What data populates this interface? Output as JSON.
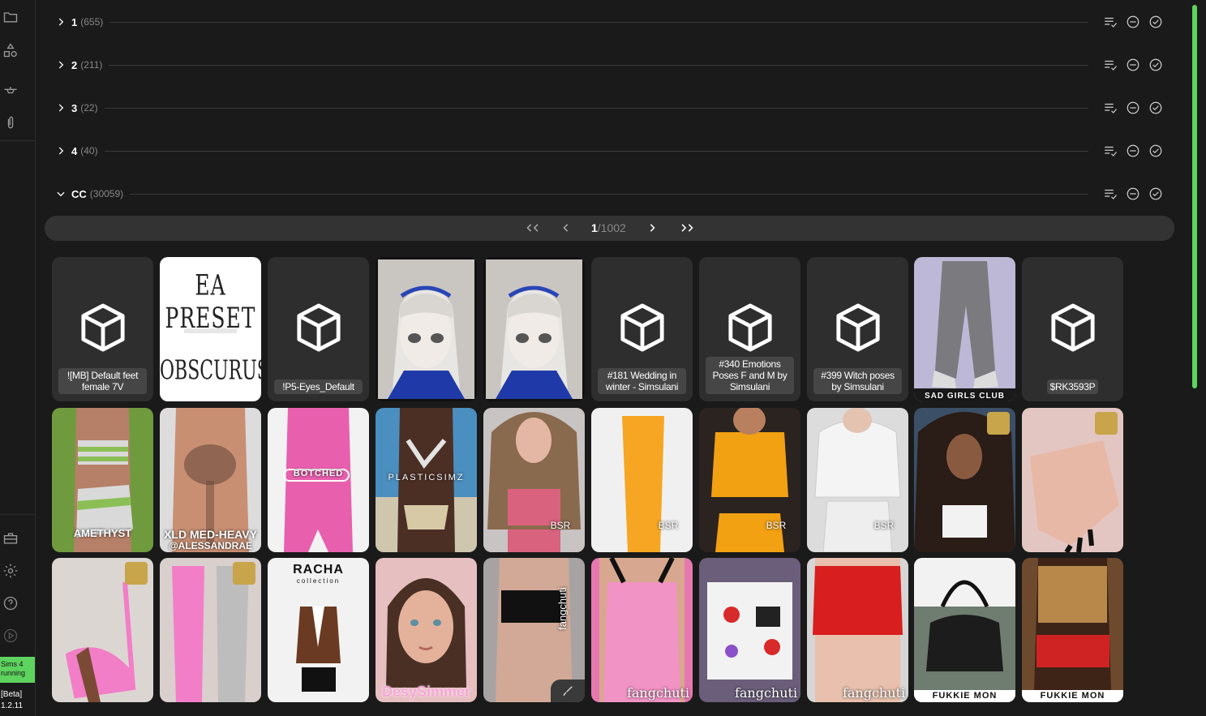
{
  "sidebar": {
    "icons": [
      "folder-icon",
      "shapes-icon",
      "hanger-icon",
      "paperclip-icon",
      "toolbox-icon",
      "gear-icon",
      "help-icon",
      "play-icon"
    ],
    "status": "Sims 4 running",
    "status_line1": "Sims 4",
    "status_line2": "running",
    "version_line1": "[Beta]",
    "version_line2": "1.2.11",
    "status_color": "#5ed35e"
  },
  "groups": [
    {
      "name": "1",
      "count": "(655)",
      "expanded": false
    },
    {
      "name": "2",
      "count": "(211)",
      "expanded": false
    },
    {
      "name": "3",
      "count": "(22)",
      "expanded": false
    },
    {
      "name": "4",
      "count": "(40)",
      "expanded": false
    },
    {
      "name": "CC",
      "count": "(30059)",
      "expanded": true
    }
  ],
  "pager": {
    "first": "<<",
    "prev": "<",
    "current": "1",
    "total": "/1002",
    "next": ">",
    "last": ">>"
  },
  "tiles_row1": [
    {
      "type": "placeholder",
      "label": "![MB] Default feet female 7V"
    },
    {
      "type": "image",
      "desc": "ea-preset",
      "top_text": "EA PRESET",
      "bottom_text": "OBSCURUS",
      "bg": "#ffffff"
    },
    {
      "type": "placeholder",
      "label": "!P5-Eyes_Default"
    },
    {
      "type": "image",
      "desc": "anime-character",
      "bg": "#c9c6c2"
    },
    {
      "type": "image",
      "desc": "anime-character",
      "bg": "#c9c6c2"
    },
    {
      "type": "placeholder",
      "label": "#181 Wedding in winter - Simsulani"
    },
    {
      "type": "placeholder",
      "label": "#340 Emotions Poses F and M by Simsulani"
    },
    {
      "type": "placeholder",
      "label": "#399 Witch poses by Simsulani"
    },
    {
      "type": "image",
      "desc": "grey-joggers",
      "bottom_text": "SAD GIRLS CLUB",
      "bg": "#bdb8d6"
    },
    {
      "type": "placeholder",
      "label": "$RK3593P"
    }
  ],
  "tiles_row2": [
    {
      "desc": "striped-top-amethyst",
      "text": "AMETHYST",
      "bg": "#6f9b3e"
    },
    {
      "desc": "male-body-hair",
      "text": "XLD MED-HEAVY",
      "subtext": "@ALESSANDRAE",
      "bg": "#c98f73"
    },
    {
      "desc": "pink-romper",
      "text": "BOTCHED",
      "bg": "#e85fae"
    },
    {
      "desc": "bikini-beach",
      "text": "PLASTICSIMZ",
      "bg": "#4a8fbf"
    },
    {
      "desc": "pink-tube-top",
      "text": "BSR",
      "bg": "#d98e96"
    },
    {
      "desc": "orange-skirt",
      "text": "BSR",
      "bg": "#f0f0f0"
    },
    {
      "desc": "orange-sweater",
      "text": "BSR",
      "bg": "#2b2320"
    },
    {
      "desc": "white-puffer",
      "text": "BSR",
      "bg": "#dcdcdc"
    },
    {
      "desc": "curly-hair",
      "text": "",
      "bg": "#3b4f66"
    },
    {
      "desc": "nails",
      "text": "",
      "bg": "#e3c6c2"
    }
  ],
  "tiles_row3": [
    {
      "desc": "pink-heels",
      "text": "",
      "bg": "#dcd6d2"
    },
    {
      "desc": "pink-grey-outfits",
      "text": "",
      "bg": "#d9cfcd"
    },
    {
      "desc": "racha-collection",
      "text": "RACHA",
      "subtext": "collection",
      "bg": "#f2f2f2"
    },
    {
      "desc": "girl-portrait",
      "text": "DesySimmer",
      "bg": "#e6bfc0"
    },
    {
      "desc": "black-crop-top",
      "text": "fangchuti",
      "bg": "#a8a3a3"
    },
    {
      "desc": "pink-tank",
      "text": "fangchuti",
      "bg": "#e678b0"
    },
    {
      "desc": "cherry-top",
      "text": "fangchuti",
      "bg": "#6b5e7a"
    },
    {
      "desc": "red-shorts",
      "text": "fangchuti",
      "bg": "#d6d6d6"
    },
    {
      "desc": "black-bag",
      "text": "FUKKIE MON",
      "bg": "#7e8a8c"
    },
    {
      "desc": "leopard-outfit",
      "text": "FUKKIE MON",
      "bg": "#6d4a2e"
    }
  ]
}
